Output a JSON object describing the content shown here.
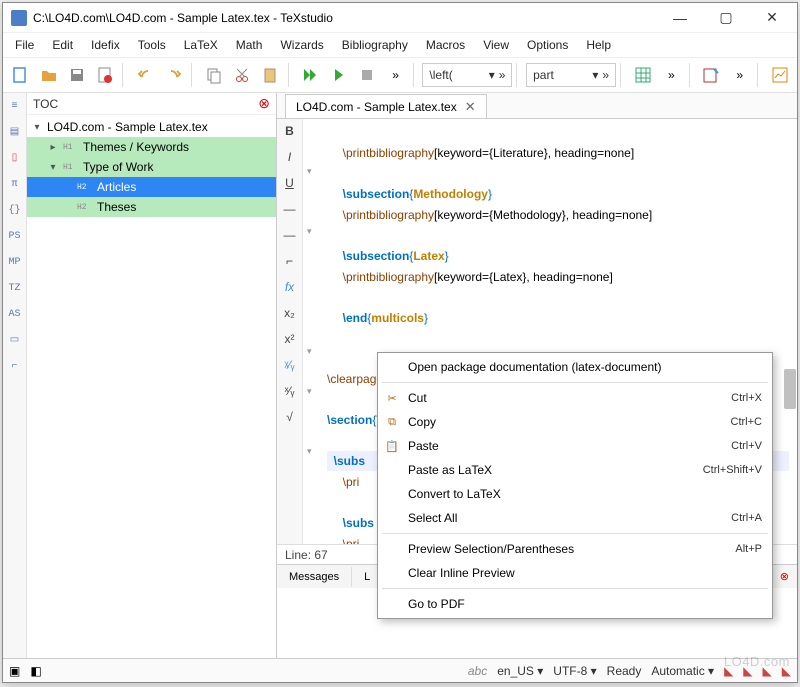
{
  "title": "C:\\LO4D.com\\LO4D.com - Sample Latex.tex - TeXstudio",
  "menu": [
    "File",
    "Edit",
    "Idefix",
    "Tools",
    "LaTeX",
    "Math",
    "Wizards",
    "Bibliography",
    "Macros",
    "View",
    "Options",
    "Help"
  ],
  "toolbar": {
    "combo1": "\\left(",
    "combo2": "part"
  },
  "toc": {
    "title": "TOC",
    "root": "LO4D.com - Sample Latex.tex",
    "items": [
      {
        "level": "H1",
        "label": "Themes / Keywords",
        "expanded": false
      },
      {
        "level": "H1",
        "label": "Type of Work",
        "expanded": true
      },
      {
        "level": "H2",
        "label": "Articles",
        "selected": true
      },
      {
        "level": "H2",
        "label": "Theses"
      }
    ]
  },
  "sidebar_icons": [
    "≡",
    "▤",
    "▯",
    "π",
    "{}",
    "PS",
    "MP",
    "TZ",
    "AS",
    "▭",
    "⌐"
  ],
  "editor": {
    "tab": "LO4D.com - Sample Latex.tex",
    "left_tools": [
      "B",
      "I",
      "U",
      "—",
      "—",
      "⌐",
      "fx",
      "x₂",
      "x²",
      "ᵡ⁄ᵧ",
      "ˣ⁄ᵧ",
      "√"
    ],
    "lines": {
      "l1_cmd": "\\printbibliography",
      "l1_opt": "[keyword={Literature}, heading=none]",
      "l3_cmd": "\\subsection",
      "l3_arg": "Methodology",
      "l4_cmd": "\\printbibliography",
      "l4_opt": "[keyword={Methodology}, heading=none]",
      "l6_cmd": "\\subsection",
      "l6_arg": "Latex",
      "l7_cmd": "\\printbibliography",
      "l7_opt": "[keyword={Latex}, heading=none]",
      "l9_cmd": "\\end",
      "l9_arg": "multicols",
      "l12_cmd": "\\clearpage",
      "l14_cmd": "\\section",
      "l14_arg": "Type of Work",
      "l16_cmd": "\\subs",
      "l17_cmd": "\\pri",
      "l19_cmd": "\\subs",
      "l20_cmd": "\\pri"
    },
    "status": "Line: 67"
  },
  "output_tabs": [
    "Messages",
    "L"
  ],
  "context_menu": [
    {
      "label": "Open package documentation (latex-document)"
    },
    {
      "sep": true
    },
    {
      "icon": "✂",
      "label": "Cut",
      "shortcut": "Ctrl+X"
    },
    {
      "icon": "⧉",
      "label": "Copy",
      "shortcut": "Ctrl+C"
    },
    {
      "icon": "📋",
      "label": "Paste",
      "shortcut": "Ctrl+V"
    },
    {
      "label": "Paste as LaTeX",
      "shortcut": "Ctrl+Shift+V"
    },
    {
      "label": "Convert to LaTeX"
    },
    {
      "label": "Select All",
      "shortcut": "Ctrl+A"
    },
    {
      "sep": true
    },
    {
      "label": "Preview Selection/Parentheses",
      "shortcut": "Alt+P"
    },
    {
      "label": "Clear Inline Preview"
    },
    {
      "sep": true
    },
    {
      "label": "Go to PDF"
    }
  ],
  "statusbar": {
    "spell": "abc",
    "lang": "en_US",
    "enc": "UTF-8",
    "state": "Ready",
    "mode": "Automatic"
  },
  "watermark": "LO4D.com"
}
